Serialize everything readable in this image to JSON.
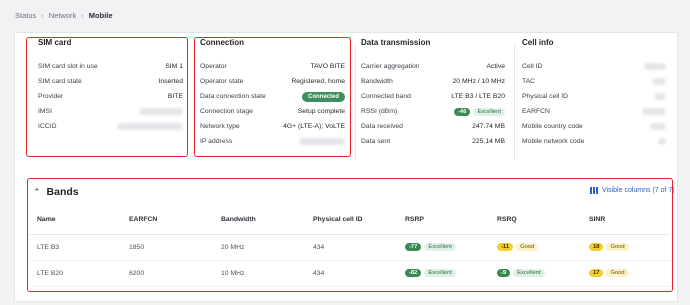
{
  "breadcrumb": {
    "items": [
      "Status",
      "Network",
      "Mobile"
    ]
  },
  "sim_card": {
    "title": "SIM card",
    "rows": [
      {
        "label": "SIM card slot in use",
        "value": "SIM 1"
      },
      {
        "label": "SIM card state",
        "value": "Inserted"
      },
      {
        "label": "Provider",
        "value": "BITE"
      },
      {
        "label": "IMSI",
        "value": ""
      },
      {
        "label": "ICCID",
        "value": ""
      }
    ]
  },
  "connection": {
    "title": "Connection",
    "rows": [
      {
        "label": "Operator",
        "value": "TAVO BITE"
      },
      {
        "label": "Operator state",
        "value": "Registered, home"
      },
      {
        "label": "Data connection state",
        "value": "Connected"
      },
      {
        "label": "Connection stage",
        "value": "Setup complete"
      },
      {
        "label": "Network type",
        "value": "4G+ (LTE-A); VoLTE"
      },
      {
        "label": "IP address",
        "value": ""
      }
    ]
  },
  "data_transmission": {
    "title": "Data transmission",
    "rows": [
      {
        "label": "Carrier aggregation",
        "value": "Active"
      },
      {
        "label": "Bandwidth",
        "value": "20 MHz / 10 MHz"
      },
      {
        "label": "Connected band",
        "value": "LTE B3 / LTE B20"
      },
      {
        "label": "RSSI (dBm)",
        "value": "-46",
        "quality": "Excellent"
      },
      {
        "label": "Data received",
        "value": "247.74 MB"
      },
      {
        "label": "Data sent",
        "value": "225.14 MB"
      }
    ]
  },
  "cell_info": {
    "title": "Cell info",
    "rows": [
      {
        "label": "Cell ID"
      },
      {
        "label": "TAC"
      },
      {
        "label": "Physical cell ID"
      },
      {
        "label": "EARFCN"
      },
      {
        "label": "Mobile country code"
      },
      {
        "label": "Mobile network code"
      }
    ]
  },
  "bands": {
    "title": "Bands",
    "visible_columns": "Visible columns (7 of 7)",
    "columns": [
      "Name",
      "EARFCN",
      "Bandwidth",
      "Physical cell ID",
      "RSRP",
      "RSRQ",
      "SINR"
    ],
    "rows": [
      {
        "name": "LTE B3",
        "earfcn": "1850",
        "bandwidth": "20 MHz",
        "pci": "434",
        "rsrp": {
          "value": "-77",
          "quality": "Excellent"
        },
        "rsrq": {
          "value": "-11",
          "quality": "Good"
        },
        "sinr": {
          "value": "18",
          "quality": "Good"
        }
      },
      {
        "name": "LTE B20",
        "earfcn": "6200",
        "bandwidth": "10 MHz",
        "pci": "434",
        "rsrp": {
          "value": "-82",
          "quality": "Excellent"
        },
        "rsrq": {
          "value": "-9",
          "quality": "Excellent"
        },
        "sinr": {
          "value": "17",
          "quality": "Good"
        }
      }
    ]
  },
  "colors": {
    "highlight": "#e3242b",
    "excellent": "#3a8a52",
    "good": "#f2cf2e",
    "link": "#2a62c9"
  }
}
